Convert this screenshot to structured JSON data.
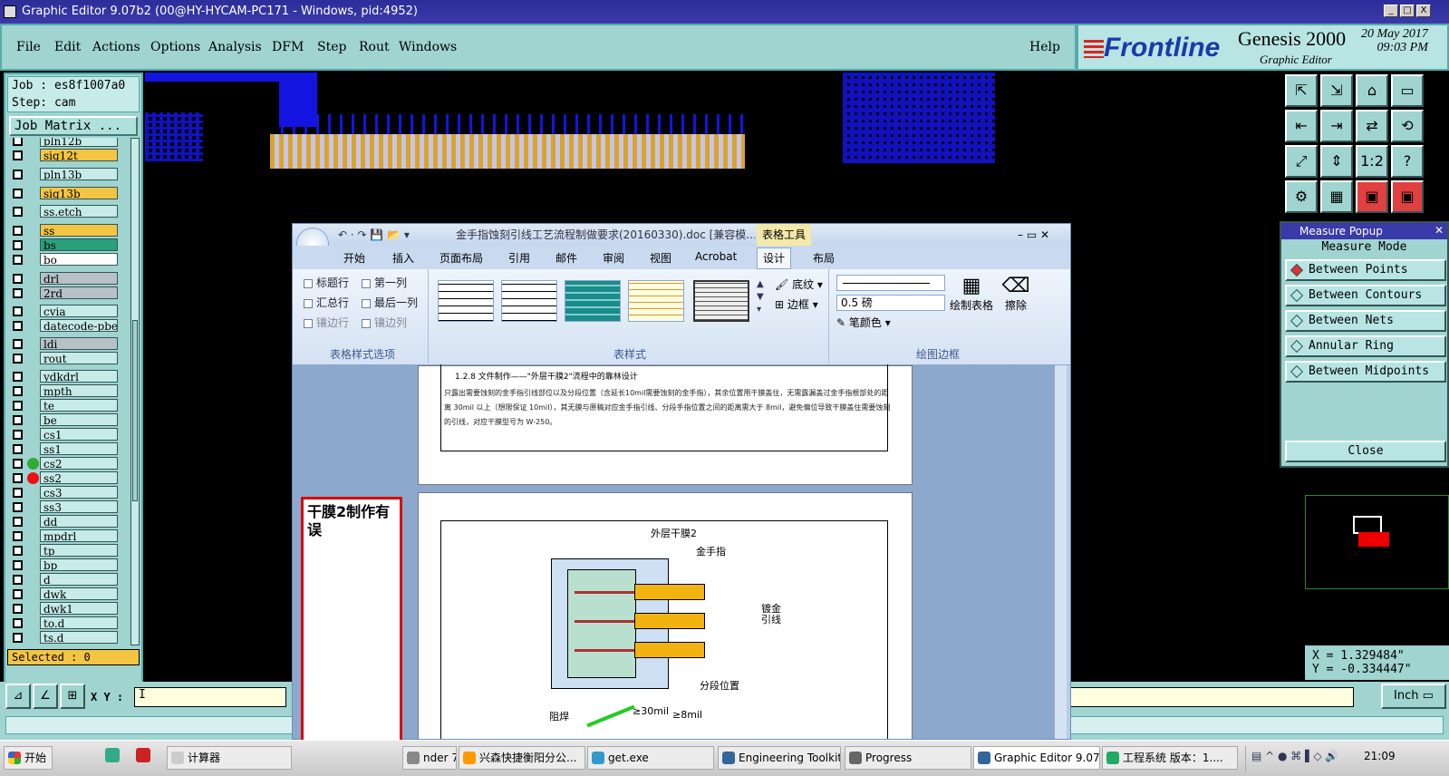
{
  "window": {
    "title": "Graphic Editor 9.07b2 (00@HY-HYCAM-PC171 - Windows, pid:4952)",
    "controls": [
      "_",
      "□",
      "X"
    ]
  },
  "menu": {
    "items": [
      "File",
      "Edit",
      "Actions",
      "Options",
      "Analysis",
      "DFM",
      "Step",
      "Rout",
      "Windows"
    ],
    "help": "Help"
  },
  "brand": {
    "logo": "Frontline",
    "product": "Genesis 2000",
    "subtitle": "Graphic Editor",
    "date": "20 May 2017",
    "time": "09:03 PM"
  },
  "job": {
    "job_line": "Job : es8f1007a0",
    "step_line": "Step: cam",
    "matrix_button": "Job Matrix ..."
  },
  "layers": [
    {
      "name": "pln12b",
      "color": "#c6ebe8"
    },
    {
      "name": "sig12t",
      "color": "#f4c542"
    },
    {
      "name": "pln13b",
      "color": "#c6ebe8"
    },
    {
      "name": "sig13b",
      "color": "#f4c542"
    },
    {
      "name": "ss.etch",
      "color": "#c6ebe8"
    },
    {
      "name": "ss",
      "color": "#f4c542"
    },
    {
      "name": "bs",
      "color": "#2aa07a"
    },
    {
      "name": "bo",
      "color": "#ffffff"
    },
    {
      "name": "drl",
      "color": "#b8c0c8"
    },
    {
      "name": "2rd",
      "color": "#b8c0c8"
    },
    {
      "name": "cvia",
      "color": "#c6ebe8"
    },
    {
      "name": "datecode-pbe",
      "color": "#c6ebe8"
    },
    {
      "name": "ldi",
      "color": "#b8c0c8"
    },
    {
      "name": "rout",
      "color": "#c6ebe8"
    },
    {
      "name": "ydkdrl",
      "color": "#c6ebe8"
    },
    {
      "name": "mpth",
      "color": "#c6ebe8"
    },
    {
      "name": "te",
      "color": "#c6ebe8"
    },
    {
      "name": "be",
      "color": "#c6ebe8"
    },
    {
      "name": "cs1",
      "color": "#c6ebe8"
    },
    {
      "name": "ss1",
      "color": "#c6ebe8"
    },
    {
      "name": "cs2",
      "color": "#c6ebe8"
    },
    {
      "name": "ss2",
      "color": "#c6ebe8"
    },
    {
      "name": "cs3",
      "color": "#c6ebe8"
    },
    {
      "name": "ss3",
      "color": "#c6ebe8"
    },
    {
      "name": "dd",
      "color": "#c6ebe8"
    },
    {
      "name": "mpdrl",
      "color": "#c6ebe8"
    },
    {
      "name": "tp",
      "color": "#c6ebe8"
    },
    {
      "name": "bp",
      "color": "#c6ebe8"
    },
    {
      "name": "d",
      "color": "#c6ebe8"
    },
    {
      "name": "dwk",
      "color": "#c6ebe8"
    },
    {
      "name": "dwk1",
      "color": "#c6ebe8"
    },
    {
      "name": "to.d",
      "color": "#c6ebe8"
    },
    {
      "name": "ts.d",
      "color": "#c6ebe8"
    }
  ],
  "selected": "Selected : 0",
  "tools": [
    "⇱",
    "⇲",
    "⌂",
    "▭",
    "⇤",
    "⇥",
    "⇄",
    "⟲",
    "⤢",
    "⇕",
    "1:2",
    "?",
    "⚙",
    "▦",
    "▣",
    "▣"
  ],
  "measure": {
    "title": "Measure Popup",
    "mode_label": "Measure Mode",
    "options": [
      "Between Points",
      "Between Contours",
      "Between Nets",
      "Annular Ring",
      "Between Midpoints"
    ],
    "close": "Close"
  },
  "coords": {
    "x": "X = 1.329484\"",
    "y": "Y = -0.334447\""
  },
  "bottom": {
    "xy_label": "X Y :",
    "xy_value": "I",
    "units": "Inch"
  },
  "word": {
    "title": "金手指蚀刻引线工艺流程制做要求(20160330).doc [兼容模... M",
    "context_tab": "表格工具",
    "tabs": [
      "开始",
      "插入",
      "页面布局",
      "引用",
      "邮件",
      "审阅",
      "视图",
      "Acrobat",
      "设计",
      "布局"
    ],
    "checkbox_opts": [
      "标题行",
      "第一列",
      "汇总行",
      "最后一列",
      "镶边行",
      "镶边列"
    ],
    "shading": "底纹",
    "border": "边框",
    "pen_weight": "0.5 磅",
    "pen_color": "笔颜色",
    "draw_table": "绘制表格",
    "eraser": "擦除",
    "group_labels": [
      "表格样式选项",
      "表样式",
      "绘图边框"
    ],
    "doc_heading": "1.2.8 文件制作——\"外层干膜2\"流程中的靠林设计",
    "doc_para": "只露出需要蚀刻的金手指引线部位以及分段位置（含延长10mil需要蚀刻的金手指），其余位置用干膜盖住，无需露漏盖过金手指根部处的距离 30mil 以上（想限保证 10mil），其无膜与原稿对应金手指引线、分段手指位置之间的距离需大于 8mil，避免偏位导致干膜盖住需要蚀刻的引线，对应干膜型号为 W-250。",
    "diagram_labels": [
      "外层干膜2",
      "金手指",
      "镀金引线",
      "分段位置",
      "阻焊",
      "≥30mil",
      "≥8mil"
    ]
  },
  "annotation": "干膜2制作有误",
  "taskbar": {
    "start": "开始",
    "items": [
      "计算器",
      "nder 7.0...",
      "兴森快捷衡阳分公...",
      "get.exe",
      "Engineering Toolkit 9....",
      "Progress",
      "Graphic Editor 9.07b2...",
      "工程系统  版本：1...."
    ],
    "clock": "21:09"
  }
}
